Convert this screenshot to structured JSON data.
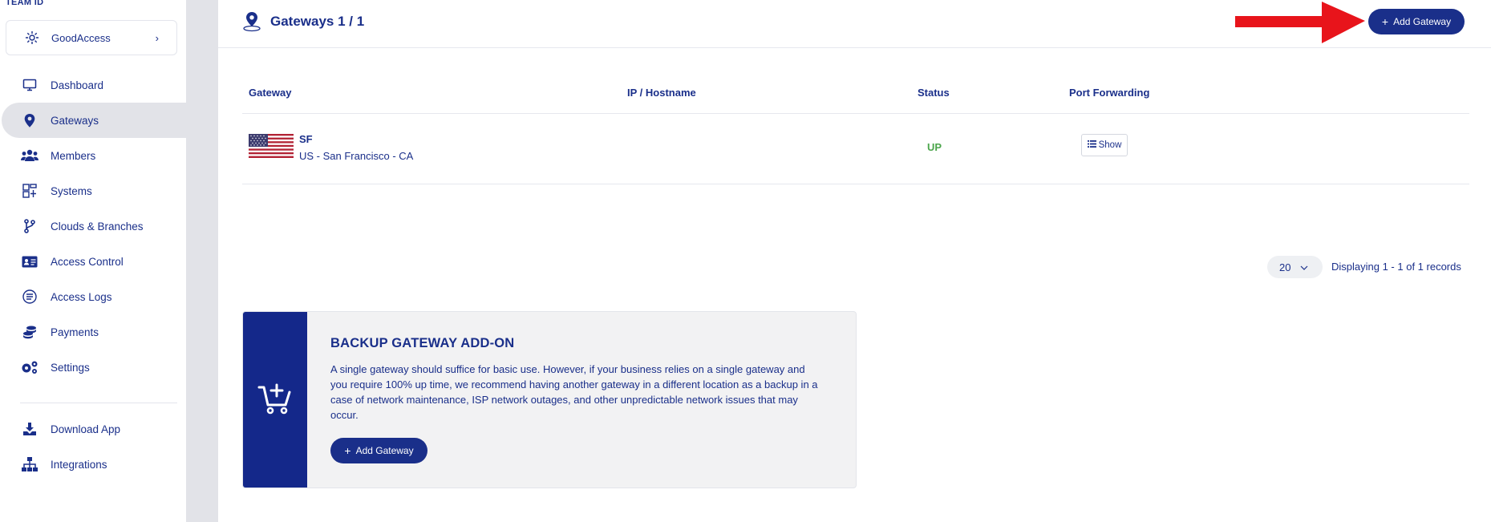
{
  "sidebar": {
    "team_label": "TEAM ID",
    "team_name": "GoodAccess",
    "nav": [
      {
        "label": "Dashboard",
        "icon": "monitor-icon"
      },
      {
        "label": "Gateways",
        "icon": "map-pin-icon",
        "active": true
      },
      {
        "label": "Members",
        "icon": "users-icon"
      },
      {
        "label": "Systems",
        "icon": "systems-icon"
      },
      {
        "label": "Clouds & Branches",
        "icon": "branch-icon"
      },
      {
        "label": "Access Control",
        "icon": "id-card-icon"
      },
      {
        "label": "Access Logs",
        "icon": "logs-icon"
      },
      {
        "label": "Payments",
        "icon": "coins-icon"
      },
      {
        "label": "Settings",
        "icon": "gears-icon"
      }
    ],
    "nav_bottom": [
      {
        "label": "Download App",
        "icon": "download-icon"
      },
      {
        "label": "Integrations",
        "icon": "sitemap-icon"
      }
    ]
  },
  "header": {
    "title": "Gateways 1 / 1",
    "add_button": "Add Gateway"
  },
  "table": {
    "columns": [
      "Gateway",
      "IP / Hostname",
      "Status",
      "Port Forwarding"
    ],
    "rows": [
      {
        "flag": "us-flag",
        "name": "SF",
        "location": "US - San Francisco - CA",
        "ip": "",
        "status": "UP",
        "action": "Show"
      }
    ]
  },
  "pagination": {
    "per_page": "20",
    "records": "Displaying 1 - 1 of 1 records"
  },
  "promo": {
    "title": "BACKUP GATEWAY ADD-ON",
    "text": "A single gateway should suffice for basic use. However, if your business relies on a single gateway and you require 100% up time, we recommend having another gateway in a different location as a backup in a case of network maintenance, ISP network outages, and other unpredictable network issues that may occur.",
    "button": "Add Gateway"
  },
  "colors": {
    "primary": "#1a2f8a",
    "status_up": "#4ca64c",
    "arrow": "#e8141b",
    "sidebar_active": "#e2e3e8"
  }
}
